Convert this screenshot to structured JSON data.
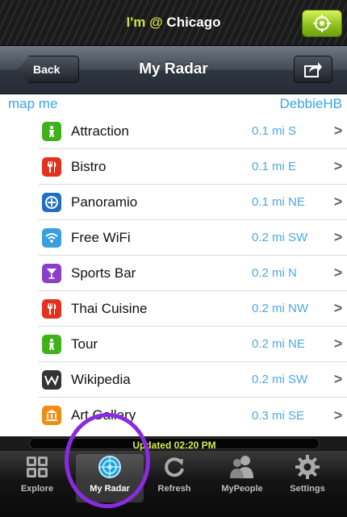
{
  "location_bar": {
    "prefix": "I'm @ ",
    "city": "Chicago",
    "locate_icon": "crosshair-icon"
  },
  "nav": {
    "title": "My Radar",
    "back_label": "Back",
    "share_icon": "share-icon"
  },
  "list": {
    "header_left": "map me",
    "header_right": "DebbieHB",
    "items": [
      {
        "name": "Attraction",
        "distance": "0.1 mi S",
        "icon": "attraction-icon",
        "color": "#3fb21b"
      },
      {
        "name": "Bistro",
        "distance": "0.1 mi E",
        "icon": "restaurant-icon",
        "color": "#e4311d"
      },
      {
        "name": "Panoramio",
        "distance": "0.1 mi NE",
        "icon": "panoramio-icon",
        "color": "#1f6fc1"
      },
      {
        "name": "Free WiFi",
        "distance": "0.2 mi SW",
        "icon": "wifi-icon",
        "color": "#3a9fe0"
      },
      {
        "name": "Sports Bar",
        "distance": "0.2 mi N",
        "icon": "cocktail-icon",
        "color": "#8a3fc8"
      },
      {
        "name": "Thai Cuisine",
        "distance": "0.2 mi NW",
        "icon": "restaurant-icon",
        "color": "#e4311d"
      },
      {
        "name": "Tour",
        "distance": "0.2 mi NE",
        "icon": "attraction-icon",
        "color": "#3fb21b"
      },
      {
        "name": "Wikipedia",
        "distance": "0.2 mi SW",
        "icon": "wikipedia-icon",
        "color": "#333333"
      },
      {
        "name": "Art Gallery",
        "distance": "0.3 mi SE",
        "icon": "museum-icon",
        "color": "#f08c12"
      }
    ]
  },
  "status": {
    "updated_text": "Updated 02:20 PM"
  },
  "tabs": [
    {
      "label": "Explore",
      "icon": "explore-icon"
    },
    {
      "label": "My Radar",
      "icon": "radar-icon",
      "active": true
    },
    {
      "label": "Refresh",
      "icon": "refresh-icon"
    },
    {
      "label": "MyPeople",
      "icon": "people-icon"
    },
    {
      "label": "Settings",
      "icon": "gear-icon"
    }
  ]
}
